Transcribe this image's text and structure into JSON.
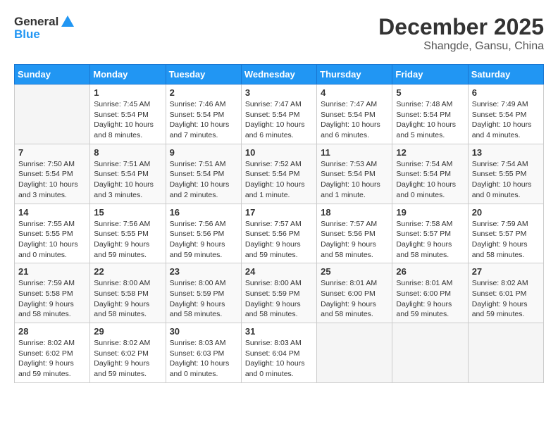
{
  "header": {
    "logo": {
      "general": "General",
      "blue": "Blue"
    },
    "month": "December 2025",
    "location": "Shangde, Gansu, China"
  },
  "weekdays": [
    "Sunday",
    "Monday",
    "Tuesday",
    "Wednesday",
    "Thursday",
    "Friday",
    "Saturday"
  ],
  "weeks": [
    [
      {
        "day": "",
        "sunrise": "",
        "sunset": "",
        "daylight": ""
      },
      {
        "day": "1",
        "sunrise": "Sunrise: 7:45 AM",
        "sunset": "Sunset: 5:54 PM",
        "daylight": "Daylight: 10 hours and 8 minutes."
      },
      {
        "day": "2",
        "sunrise": "Sunrise: 7:46 AM",
        "sunset": "Sunset: 5:54 PM",
        "daylight": "Daylight: 10 hours and 7 minutes."
      },
      {
        "day": "3",
        "sunrise": "Sunrise: 7:47 AM",
        "sunset": "Sunset: 5:54 PM",
        "daylight": "Daylight: 10 hours and 6 minutes."
      },
      {
        "day": "4",
        "sunrise": "Sunrise: 7:47 AM",
        "sunset": "Sunset: 5:54 PM",
        "daylight": "Daylight: 10 hours and 6 minutes."
      },
      {
        "day": "5",
        "sunrise": "Sunrise: 7:48 AM",
        "sunset": "Sunset: 5:54 PM",
        "daylight": "Daylight: 10 hours and 5 minutes."
      },
      {
        "day": "6",
        "sunrise": "Sunrise: 7:49 AM",
        "sunset": "Sunset: 5:54 PM",
        "daylight": "Daylight: 10 hours and 4 minutes."
      }
    ],
    [
      {
        "day": "7",
        "sunrise": "Sunrise: 7:50 AM",
        "sunset": "Sunset: 5:54 PM",
        "daylight": "Daylight: 10 hours and 3 minutes."
      },
      {
        "day": "8",
        "sunrise": "Sunrise: 7:51 AM",
        "sunset": "Sunset: 5:54 PM",
        "daylight": "Daylight: 10 hours and 3 minutes."
      },
      {
        "day": "9",
        "sunrise": "Sunrise: 7:51 AM",
        "sunset": "Sunset: 5:54 PM",
        "daylight": "Daylight: 10 hours and 2 minutes."
      },
      {
        "day": "10",
        "sunrise": "Sunrise: 7:52 AM",
        "sunset": "Sunset: 5:54 PM",
        "daylight": "Daylight: 10 hours and 1 minute."
      },
      {
        "day": "11",
        "sunrise": "Sunrise: 7:53 AM",
        "sunset": "Sunset: 5:54 PM",
        "daylight": "Daylight: 10 hours and 1 minute."
      },
      {
        "day": "12",
        "sunrise": "Sunrise: 7:54 AM",
        "sunset": "Sunset: 5:54 PM",
        "daylight": "Daylight: 10 hours and 0 minutes."
      },
      {
        "day": "13",
        "sunrise": "Sunrise: 7:54 AM",
        "sunset": "Sunset: 5:55 PM",
        "daylight": "Daylight: 10 hours and 0 minutes."
      }
    ],
    [
      {
        "day": "14",
        "sunrise": "Sunrise: 7:55 AM",
        "sunset": "Sunset: 5:55 PM",
        "daylight": "Daylight: 10 hours and 0 minutes."
      },
      {
        "day": "15",
        "sunrise": "Sunrise: 7:56 AM",
        "sunset": "Sunset: 5:55 PM",
        "daylight": "Daylight: 9 hours and 59 minutes."
      },
      {
        "day": "16",
        "sunrise": "Sunrise: 7:56 AM",
        "sunset": "Sunset: 5:56 PM",
        "daylight": "Daylight: 9 hours and 59 minutes."
      },
      {
        "day": "17",
        "sunrise": "Sunrise: 7:57 AM",
        "sunset": "Sunset: 5:56 PM",
        "daylight": "Daylight: 9 hours and 59 minutes."
      },
      {
        "day": "18",
        "sunrise": "Sunrise: 7:57 AM",
        "sunset": "Sunset: 5:56 PM",
        "daylight": "Daylight: 9 hours and 58 minutes."
      },
      {
        "day": "19",
        "sunrise": "Sunrise: 7:58 AM",
        "sunset": "Sunset: 5:57 PM",
        "daylight": "Daylight: 9 hours and 58 minutes."
      },
      {
        "day": "20",
        "sunrise": "Sunrise: 7:59 AM",
        "sunset": "Sunset: 5:57 PM",
        "daylight": "Daylight: 9 hours and 58 minutes."
      }
    ],
    [
      {
        "day": "21",
        "sunrise": "Sunrise: 7:59 AM",
        "sunset": "Sunset: 5:58 PM",
        "daylight": "Daylight: 9 hours and 58 minutes."
      },
      {
        "day": "22",
        "sunrise": "Sunrise: 8:00 AM",
        "sunset": "Sunset: 5:58 PM",
        "daylight": "Daylight: 9 hours and 58 minutes."
      },
      {
        "day": "23",
        "sunrise": "Sunrise: 8:00 AM",
        "sunset": "Sunset: 5:59 PM",
        "daylight": "Daylight: 9 hours and 58 minutes."
      },
      {
        "day": "24",
        "sunrise": "Sunrise: 8:00 AM",
        "sunset": "Sunset: 5:59 PM",
        "daylight": "Daylight: 9 hours and 58 minutes."
      },
      {
        "day": "25",
        "sunrise": "Sunrise: 8:01 AM",
        "sunset": "Sunset: 6:00 PM",
        "daylight": "Daylight: 9 hours and 58 minutes."
      },
      {
        "day": "26",
        "sunrise": "Sunrise: 8:01 AM",
        "sunset": "Sunset: 6:00 PM",
        "daylight": "Daylight: 9 hours and 59 minutes."
      },
      {
        "day": "27",
        "sunrise": "Sunrise: 8:02 AM",
        "sunset": "Sunset: 6:01 PM",
        "daylight": "Daylight: 9 hours and 59 minutes."
      }
    ],
    [
      {
        "day": "28",
        "sunrise": "Sunrise: 8:02 AM",
        "sunset": "Sunset: 6:02 PM",
        "daylight": "Daylight: 9 hours and 59 minutes."
      },
      {
        "day": "29",
        "sunrise": "Sunrise: 8:02 AM",
        "sunset": "Sunset: 6:02 PM",
        "daylight": "Daylight: 9 hours and 59 minutes."
      },
      {
        "day": "30",
        "sunrise": "Sunrise: 8:03 AM",
        "sunset": "Sunset: 6:03 PM",
        "daylight": "Daylight: 10 hours and 0 minutes."
      },
      {
        "day": "31",
        "sunrise": "Sunrise: 8:03 AM",
        "sunset": "Sunset: 6:04 PM",
        "daylight": "Daylight: 10 hours and 0 minutes."
      },
      {
        "day": "",
        "sunrise": "",
        "sunset": "",
        "daylight": ""
      },
      {
        "day": "",
        "sunrise": "",
        "sunset": "",
        "daylight": ""
      },
      {
        "day": "",
        "sunrise": "",
        "sunset": "",
        "daylight": ""
      }
    ]
  ]
}
